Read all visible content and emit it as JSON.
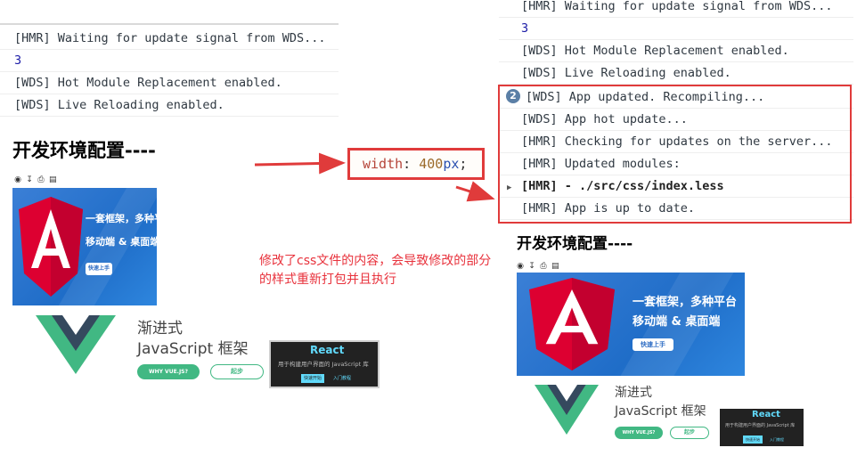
{
  "left_console": {
    "rows": [
      "[HMR] Waiting for update signal from WDS...",
      "3",
      "[WDS] Hot Module Replacement enabled.",
      "[WDS] Live Reloading enabled."
    ]
  },
  "left_page": {
    "heading": "开发环境配置----",
    "toolbar_icons": [
      "eye-icon",
      "download-icon",
      "print-icon",
      "save-icon"
    ],
    "angular_banner": {
      "line1": "一套框架，多种平台",
      "line2": "移动端 & 桌面端",
      "button": "快速上手"
    },
    "vue": {
      "title_line1": "渐进式",
      "title_line2": "JavaScript 框架",
      "button_why": "WHY VUE.JS?",
      "button_start": "起步"
    },
    "react": {
      "title": "React",
      "subtitle": "用于构建用户界面的 JavaScript 库",
      "button": "快速开始",
      "link": "入门教程"
    }
  },
  "code_box": {
    "property": "width",
    "colon": ": ",
    "number": "400",
    "unit": "px",
    "semicolon": ";"
  },
  "annotation": "修改了css文件的内容，会导致修改的部分的样式重新打包并且执行",
  "right_console": {
    "rows_top": [
      "[HMR] Waiting for update signal from WDS...",
      "3",
      "[WDS] Hot Module Replacement enabled.",
      "[WDS] Live Reloading enabled."
    ],
    "badge_count": "2",
    "rows_highlighted": [
      "[WDS] App updated. Recompiling...",
      "[WDS] App hot update...",
      "[HMR] Checking for updates on the server...",
      "[HMR] Updated modules:",
      "[HMR]  - ./src/css/index.less",
      "[HMR] App is up to date."
    ]
  },
  "right_page": {
    "heading": "开发环境配置----",
    "angular_banner": {
      "line1": "一套框架，多种平台",
      "line2": "移动端 & 桌面端",
      "button": "快速上手"
    },
    "vue": {
      "title_line1": "渐进式",
      "title_line2": "JavaScript 框架",
      "button_why": "WHY VUE.JS?",
      "button_start": "起步"
    },
    "react": {
      "title": "React",
      "subtitle": "用于构建用户界面的 JavaScript 库",
      "button": "快速开始",
      "link": "入门教程"
    }
  },
  "colors": {
    "accent_red": "#e03b3b",
    "annotation_red": "#e8323c",
    "angular_red": "#dd0031",
    "vue_green": "#41b883",
    "vue_dark": "#35495e",
    "react_blue": "#61dafb"
  }
}
